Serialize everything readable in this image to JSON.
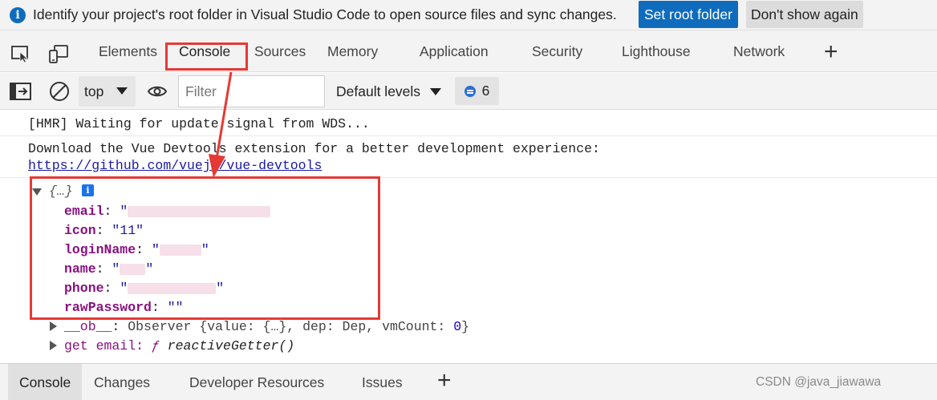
{
  "infobar": {
    "message": "Identify your project's root folder in Visual Studio Code to open source files and sync changes.",
    "primary_button": "Set root folder",
    "secondary_button": "Don't show again",
    "info_icon": "info-icon"
  },
  "tabs": [
    {
      "label": "Elements",
      "active": false
    },
    {
      "label": "Console",
      "active": true
    },
    {
      "label": "Sources",
      "active": false
    },
    {
      "label": "Memory",
      "active": false
    },
    {
      "label": "Application",
      "active": false
    },
    {
      "label": "Security",
      "active": false
    },
    {
      "label": "Lighthouse",
      "active": false
    },
    {
      "label": "Network",
      "active": false
    }
  ],
  "toolbar": {
    "context": "top",
    "filter_placeholder": "Filter",
    "levels": "Default levels",
    "message_count": "6"
  },
  "console": {
    "hmr": "[HMR] Waiting for update signal from WDS...",
    "devtools_text": "Download the Vue Devtools extension for a better development experience:",
    "devtools_link": "https://github.com/vuejs/vue-devtools",
    "object_summary": "{…}",
    "fields": {
      "email": "email",
      "icon": "icon",
      "icon_value": "\"11\"",
      "loginName": "loginName",
      "name": "name",
      "phone": "phone",
      "rawPassword": "rawPassword",
      "rawPassword_value": "\"\"",
      "quote": "\"",
      "colon": ":"
    },
    "ob_key": "__ob__",
    "ob_value_prefix": "Observer {value: {…}, dep: Dep, vmCount: ",
    "ob_vmcount": "0",
    "ob_value_suffix": "}",
    "getter_prefix": "get email:",
    "getter_fn": "ƒ",
    "getter_name": "reactiveGetter()"
  },
  "drawer_tabs": [
    {
      "label": "Console",
      "active": true
    },
    {
      "label": "Changes",
      "active": false
    },
    {
      "label": "Developer Resources",
      "active": false
    },
    {
      "label": "Issues",
      "active": false
    }
  ],
  "watermark": "CSDN @java_jiawawa",
  "colors": {
    "accent": "#0f6cbd",
    "annotation": "#e53935",
    "property_key": "#881280",
    "string_value": "#1a1aa6"
  }
}
